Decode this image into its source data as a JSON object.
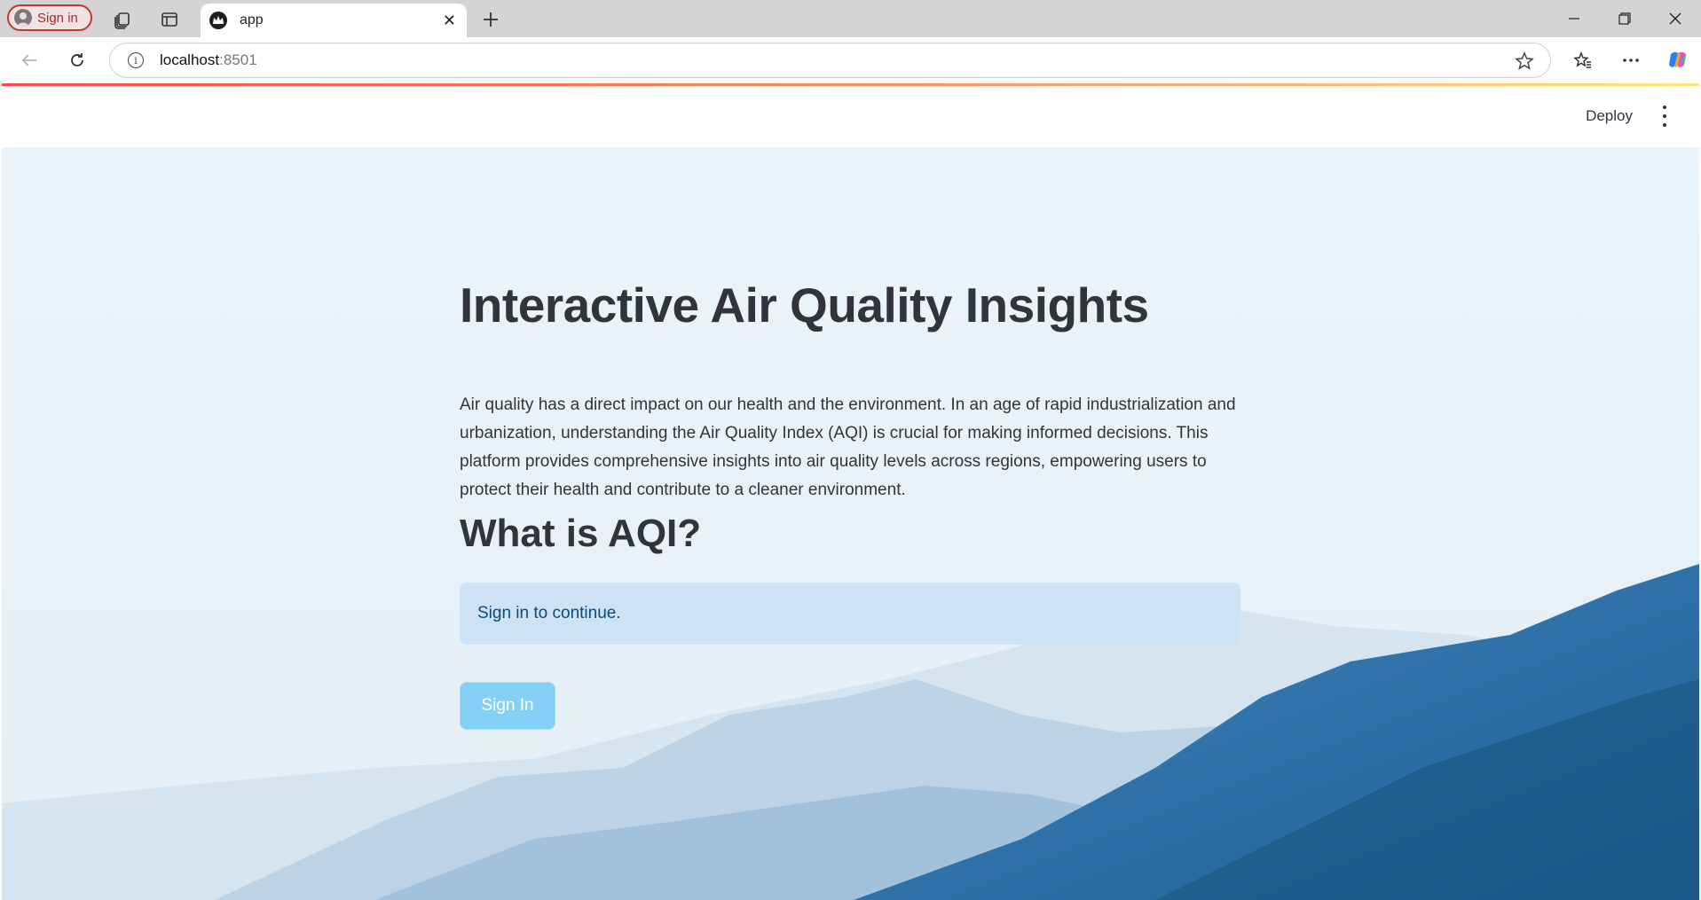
{
  "browser": {
    "profile_label": "Sign in",
    "tab_title": "app",
    "url_host": "localhost",
    "url_port": ":8501"
  },
  "app_header": {
    "deploy_label": "Deploy"
  },
  "main": {
    "title": "Interactive Air Quality Insights",
    "intro": "Air quality has a direct impact on our health and the environment. In an age of rapid industrialization and urbanization, understanding the Air Quality Index (AQI) is crucial for making informed decisions. This platform provides comprehensive insights into air quality levels across regions, empowering users to protect their health and contribute to a cleaner environment.",
    "section_title": "What is AQI?",
    "info_message": "Sign in to continue.",
    "signin_button": "Sign In"
  },
  "colors": {
    "text": "#31333f",
    "info_bg": "#cde2f5",
    "info_text": "#0b4a7d",
    "button_bg": "#85d0f6",
    "profile_accent": "#c0392b"
  }
}
